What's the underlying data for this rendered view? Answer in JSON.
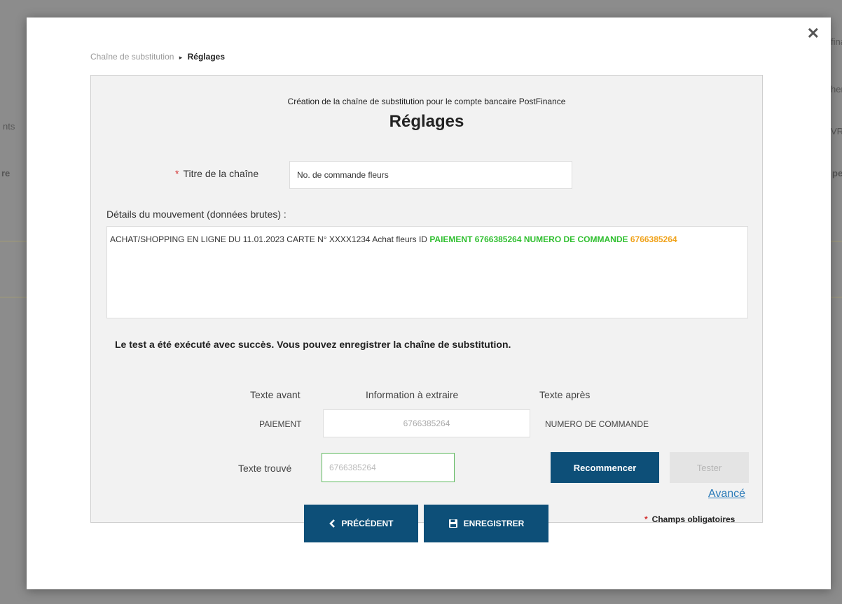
{
  "background": {
    "top_right_text": "fina",
    "right_text_1": "her",
    "left_text_1": "nts",
    "right_text_2": "VR",
    "left_text_2": "re",
    "right_text_3": "pe"
  },
  "breadcrumb": {
    "parent": "Chaîne de substitution",
    "separator": "▸",
    "current": "Réglages"
  },
  "header": {
    "subtitle": "Création de la chaîne de substitution pour le compte bancaire PostFinance",
    "title": "Réglages"
  },
  "form": {
    "title_label": "Titre de la chaîne",
    "required_marker": "*",
    "title_value": "No. de commande fleurs",
    "details_label": "Détails du mouvement (données brutes) :",
    "details_plain": "ACHAT/SHOPPING EN LIGNE DU 11.01.2023 CARTE N° XXXX1234 Achat fleurs ID ",
    "details_green": "PAIEMENT 6766385264 NUMERO DE COMMANDE",
    "details_orange": "6766385264",
    "success_message": "Le test a été exécuté avec succès. Vous pouvez enregistrer la chaîne de substitution."
  },
  "extraction": {
    "col_before": "Texte avant",
    "col_info": "Information à extraire",
    "col_after": "Texte après",
    "before_value": "PAIEMENT",
    "info_value": "6766385264",
    "after_value": "NUMERO DE COMMANDE",
    "found_label": "Texte trouvé",
    "found_value": "6766385264"
  },
  "buttons": {
    "restart": "Recommencer",
    "test": "Tester",
    "advanced": "Avancé",
    "previous": "PRÉCÉDENT",
    "save": "ENREGISTRER"
  },
  "footer": {
    "required_note": "Champs obligatoires"
  },
  "colors": {
    "primary_button": "#0d4f78",
    "highlight_green": "#2fbf2f",
    "highlight_orange": "#f0a21a",
    "required_red": "#d32f2f",
    "link_blue": "#2a7ab8"
  }
}
